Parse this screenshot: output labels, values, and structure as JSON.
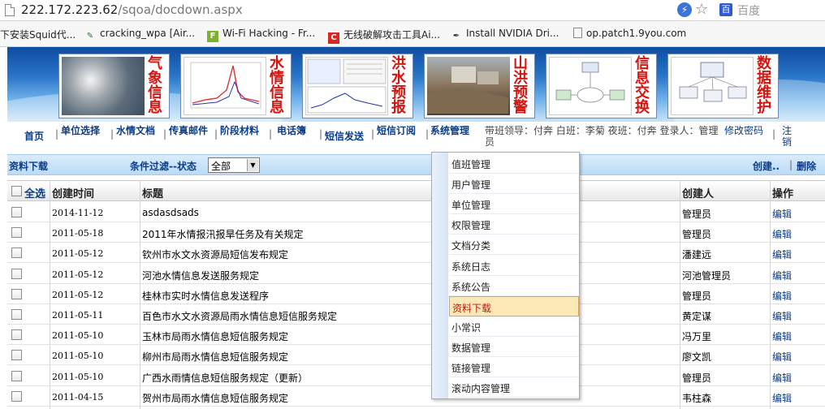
{
  "browser": {
    "url_host": "222.172.223.62",
    "url_path": "/sqoa/docdown.aspx",
    "search_placeholder": "百度",
    "bookmarks": [
      {
        "label": "下安装Squid代...",
        "icon": "none"
      },
      {
        "label": "cracking_wpa [Air...",
        "icon": "pencil-icon"
      },
      {
        "label": "Wi-Fi Hacking - Fr...",
        "icon": "f-icon"
      },
      {
        "label": "无线破解攻击工具Ai...",
        "icon": "c-icon"
      },
      {
        "label": "Install NVIDIA Dri...",
        "icon": "tool-icon"
      },
      {
        "label": "op.patch1.9you.com",
        "icon": "page-icon"
      }
    ]
  },
  "header": {
    "tiles": [
      {
        "label": "气象信息",
        "pic": "cloud-satellite-image"
      },
      {
        "label": "水情信息",
        "pic": "water-level-chart"
      },
      {
        "label": "洪水预报",
        "pic": "flood-forecast-chart"
      },
      {
        "label": "山洪预警",
        "pic": "landslide-photo"
      },
      {
        "label": "信息交换",
        "pic": "exchange-diagram"
      },
      {
        "label": "数据维护",
        "pic": "computer-network-diagram"
      }
    ]
  },
  "nav": {
    "items": [
      "首页",
      "单位选择",
      "水情文档",
      "传真邮件",
      "阶段材料",
      "电话簿",
      "短信发送",
      "短信订阅",
      "系统管理"
    ],
    "duty_info": "带班领导：付奔 白班：李菊 夜班：付奔 登录人：管理员",
    "change_password": "修改密码",
    "logout": "注销"
  },
  "toolbar": {
    "title": "资料下载",
    "filter_label": "条件过滤--状态",
    "filter_value": "全部",
    "create": "创建..",
    "delete": "删除"
  },
  "table": {
    "headers": {
      "select_all": "全选",
      "created": "创建时间",
      "title": "标题",
      "creator": "创建人",
      "action": "操作"
    },
    "rows": [
      {
        "date": "2014-11-12",
        "title": "asdasdsads",
        "creator": "管理员",
        "action": "编辑"
      },
      {
        "date": "2011-05-18",
        "title": "2011年水情报汛报旱任务及有关规定",
        "creator": "管理员",
        "action": "编辑"
      },
      {
        "date": "2011-05-12",
        "title": "钦州市水文水资源局短信发布规定",
        "creator": "潘建远",
        "action": "编辑"
      },
      {
        "date": "2011-05-12",
        "title": "河池水情信息发送服务规定",
        "creator": "河池管理员",
        "action": "编辑"
      },
      {
        "date": "2011-05-12",
        "title": "桂林市实时水情信息发送程序",
        "creator": "管理员",
        "action": "编辑"
      },
      {
        "date": "2011-05-11",
        "title": "百色市水文水资源局雨水情信息短信服务规定",
        "creator": "黄定谋",
        "action": "编辑"
      },
      {
        "date": "2011-05-10",
        "title": "玉林市局雨水情信息短信服务规定",
        "creator": "冯万里",
        "action": "编辑"
      },
      {
        "date": "2011-05-10",
        "title": "柳州市局雨水情信息短信服务规定",
        "creator": "廖文凯",
        "action": "编辑"
      },
      {
        "date": "2011-05-10",
        "title": "广西水雨情信息短信服务规定（更新）",
        "creator": "管理员",
        "action": "编辑"
      },
      {
        "date": "2011-04-15",
        "title": "贺州市局雨水情信息短信服务规定",
        "creator": "韦柱森",
        "action": "编辑"
      }
    ]
  },
  "dropdown": {
    "items": [
      "值班管理",
      "用户管理",
      "单位管理",
      "权限管理",
      "文档分类",
      "系统日志",
      "系统公告",
      "资料下载",
      "小常识",
      "数据管理",
      "链接管理",
      "滚动内容管理"
    ],
    "selected": "资料下载"
  },
  "colors": {
    "nav_text": "#0a3c8a",
    "tile_label": "#d4150f",
    "menu_selected_bg": "#fde9b8"
  }
}
